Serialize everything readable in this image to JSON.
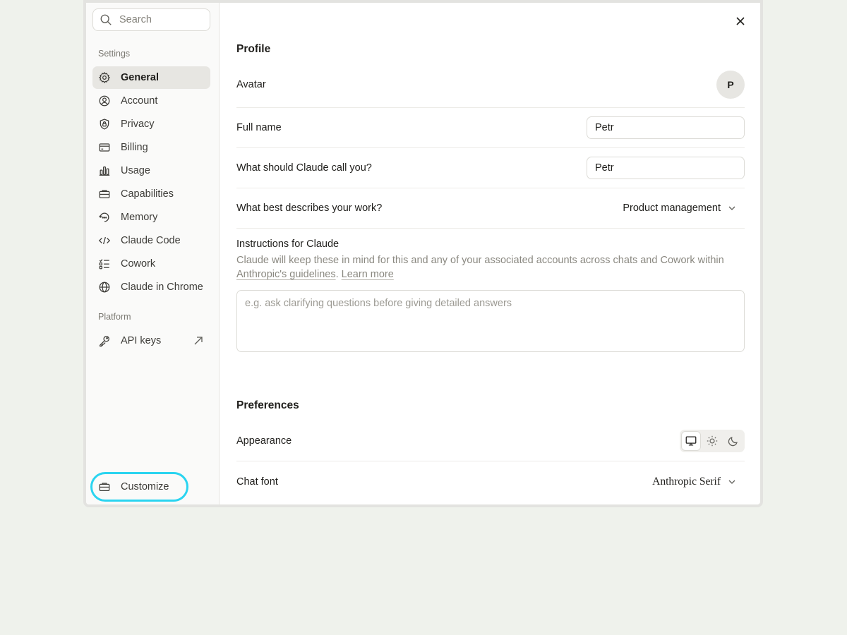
{
  "sidebar": {
    "search_placeholder": "Search",
    "settings_label": "Settings",
    "items": [
      {
        "label": "General",
        "icon": "gear-icon",
        "active": true
      },
      {
        "label": "Account",
        "icon": "user-circle-icon"
      },
      {
        "label": "Privacy",
        "icon": "shield-lock-icon"
      },
      {
        "label": "Billing",
        "icon": "credit-card-icon"
      },
      {
        "label": "Usage",
        "icon": "bar-chart-icon"
      },
      {
        "label": "Capabilities",
        "icon": "briefcase-icon"
      },
      {
        "label": "Memory",
        "icon": "history-icon"
      },
      {
        "label": "Claude Code",
        "icon": "code-icon"
      },
      {
        "label": "Cowork",
        "icon": "checklist-icon"
      },
      {
        "label": "Claude in Chrome",
        "icon": "globe-icon"
      }
    ],
    "platform_label": "Platform",
    "platform_items": [
      {
        "label": "API keys",
        "icon": "key-icon",
        "external": true
      }
    ],
    "customize_label": "Customize"
  },
  "main": {
    "profile_heading": "Profile",
    "avatar_label": "Avatar",
    "avatar_initial": "P",
    "full_name_label": "Full name",
    "full_name_value": "Petr",
    "call_you_label": "What should Claude call you?",
    "call_you_value": "Petr",
    "work_label": "What best describes your work?",
    "work_value": "Product management",
    "instructions_title": "Instructions for Claude",
    "instructions_desc": "Claude will keep these in mind for this and any of your associated accounts across chats and Cowork within ",
    "guidelines_link": "Anthropic's guidelines",
    "desc_separator": ". ",
    "learn_more_link": "Learn more",
    "instructions_placeholder": "e.g. ask clarifying questions before giving detailed answers",
    "preferences_heading": "Preferences",
    "appearance_label": "Appearance",
    "appearance_options": [
      "system",
      "light",
      "dark"
    ],
    "appearance_selected": "system",
    "chat_font_label": "Chat font",
    "chat_font_value": "Anthropic Serif"
  }
}
